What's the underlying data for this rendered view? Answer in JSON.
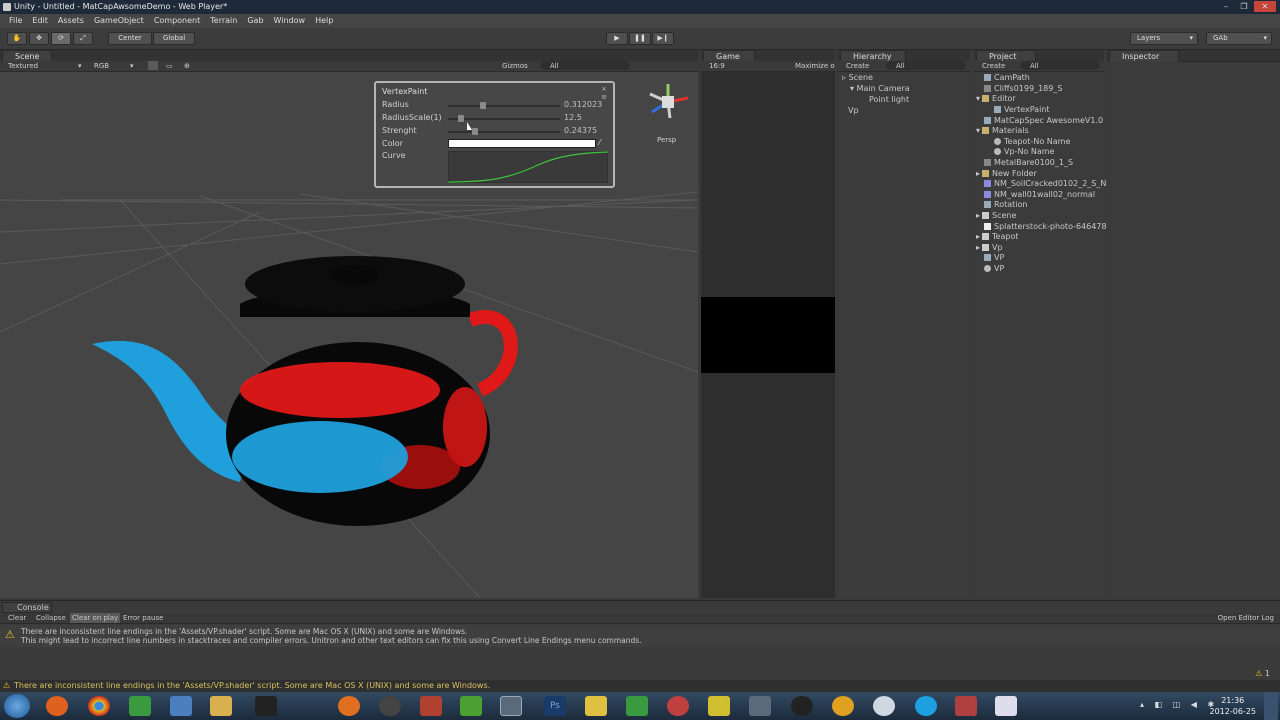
{
  "window": {
    "title": "Unity - Untitled - MatCapAwsomeDemo - Web Player*"
  },
  "menu": [
    "File",
    "Edit",
    "Assets",
    "GameObject",
    "Component",
    "Terrain",
    "Gab",
    "Window",
    "Help"
  ],
  "toolbar": {
    "pivot_center": "Center",
    "pivot_global": "Global",
    "layers": "Layers",
    "layout": "GAb"
  },
  "scene": {
    "tab": "Scene",
    "render_mode": "Textured",
    "color_mode": "RGB",
    "gizmos": "Gizmos",
    "search": "All",
    "persp": "Persp"
  },
  "vertex_paint": {
    "title": "VertexPaint",
    "radius_label": "Radius",
    "radius_value": "0.312023",
    "radius_fraction": 0.31,
    "radius_scale_label": "RadiusScale(1)",
    "radius_scale_value": "12.5",
    "radius_scale_fraction": 0.12,
    "strength_label": "Strenght",
    "strength_value": "0.24375",
    "strength_fraction": 0.24,
    "color_label": "Color",
    "curve_label": "Curve"
  },
  "game": {
    "tab": "Game",
    "aspect": "16:9",
    "maximize": "Maximize on Play"
  },
  "hierarchy": {
    "tab": "Hierarchy",
    "create": "Create",
    "search": "All",
    "items": [
      "Scene",
      "Main Camera",
      "Point light",
      "Vp"
    ]
  },
  "project": {
    "tab": "Project",
    "create": "Create",
    "search": "All",
    "items": [
      "CamPath",
      "Cliffs0199_189_S",
      "Editor",
      "VertexPaint",
      "MatCapSpec AwesomeV1.0",
      "Materials",
      "Teapot-No Name",
      "Vp-No Name",
      "MetalBare0100_1_S",
      "New Folder",
      "NM_SoilCracked0102_2_S_N",
      "NM_wall01wall02_normal",
      "Rotation",
      "Scene",
      "Splatterstock-photo-646478-",
      "Teapot",
      "Vp",
      "VP",
      "VP"
    ]
  },
  "inspector": {
    "tab": "Inspector"
  },
  "console": {
    "tab": "Console",
    "clear": "Clear",
    "collapse": "Collapse",
    "clear_on_play": "Clear on play",
    "error_pause": "Error pause",
    "open_editor_log": "Open Editor Log",
    "message_line1": "There are inconsistent line endings in the 'Assets/VP.shader' script. Some are Mac OS X (UNIX) and some are Windows.",
    "message_line2": "This might lead to incorrect line numbers in stacktraces and compiler errors. Unitron and other text editors can fix this using Convert Line Endings menu commands.",
    "count": "1"
  },
  "status": "There are inconsistent line endings in the 'Assets/VP.shader' script. Some are Mac OS X (UNIX) and some are Windows.",
  "clock": {
    "time": "21:36",
    "date": "2012-06-25"
  },
  "colors": {
    "teapot_blue": "#1fa0dc",
    "teapot_red": "#e01818",
    "curve_green": "#3cc43c",
    "warning": "#e0c020"
  }
}
